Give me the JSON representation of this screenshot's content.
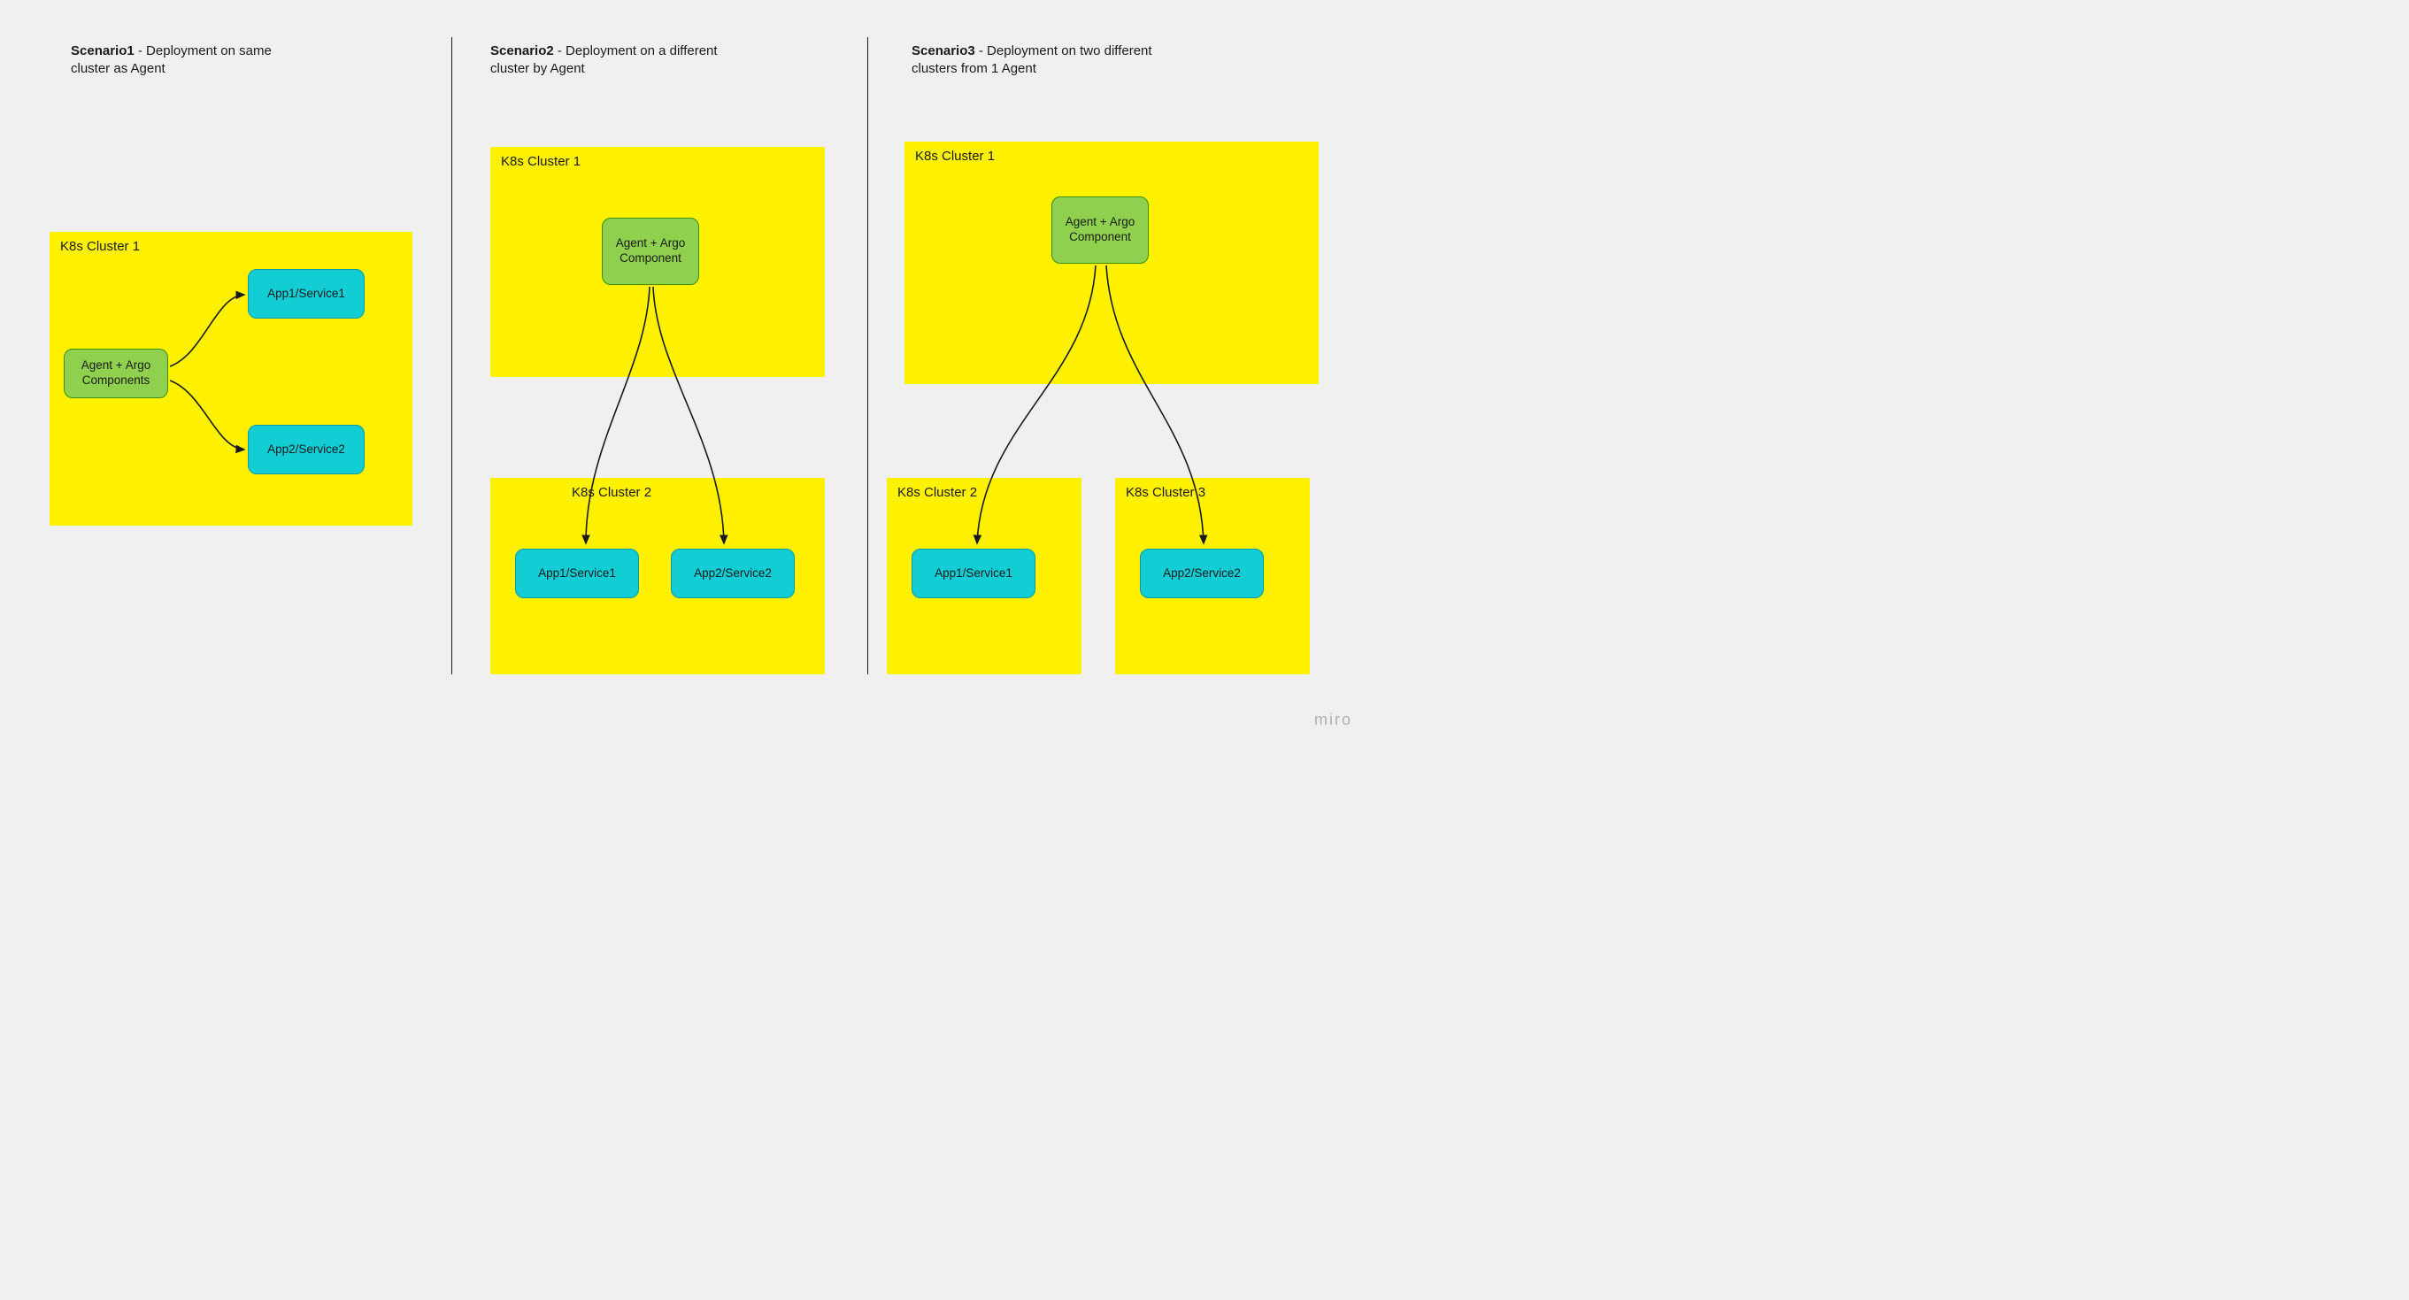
{
  "watermark": "miro",
  "scenario1": {
    "title_bold": "Scenario1",
    "title_rest": " - Deployment on same cluster as Agent",
    "cluster1": {
      "label": "K8s Cluster 1",
      "agent": "Agent + Argo Components",
      "app1": "App1/Service1",
      "app2": "App2/Service2"
    }
  },
  "scenario2": {
    "title_bold": "Scenario2",
    "title_rest": " - Deployment on a different cluster by Agent",
    "cluster1": {
      "label": "K8s Cluster 1",
      "agent": "Agent + Argo Component"
    },
    "cluster2": {
      "label": "K8s Cluster 2",
      "app1": "App1/Service1",
      "app2": "App2/Service2"
    }
  },
  "scenario3": {
    "title_bold": "Scenario3",
    "title_rest": " - Deployment on two different clusters from 1 Agent",
    "cluster1": {
      "label": "K8s Cluster 1",
      "agent": "Agent + Argo Component"
    },
    "cluster2": {
      "label": "K8s Cluster 2",
      "app1": "App1/Service1"
    },
    "cluster3": {
      "label": "K8s Cluster 3",
      "app2": "App2/Service2"
    }
  }
}
